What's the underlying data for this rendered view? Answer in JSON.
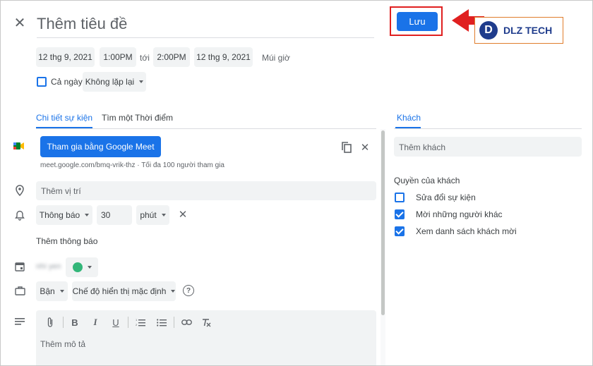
{
  "header": {
    "title_placeholder": "Thêm tiêu đề",
    "save_label": "Lưu"
  },
  "watermark": {
    "brand": "DLZ TECH",
    "letter": "D"
  },
  "datetime": {
    "start_date": "12 thg 9, 2021",
    "start_time": "1:00PM",
    "to_label": "tới",
    "end_time": "2:00PM",
    "end_date": "12 thg 9, 2021",
    "timezone_label": "Múi giờ",
    "all_day_label": "Cả ngày",
    "all_day_checked": false,
    "repeat_value": "Không lặp lại"
  },
  "tabs": [
    {
      "label": "Chi tiết sự kiện",
      "active": true
    },
    {
      "label": "Tìm một Thời điểm",
      "active": false
    }
  ],
  "meet": {
    "button_label": "Tham gia bằng Google Meet",
    "info": "meet.google.com/bmq-vrik-thz · Tối đa 100 người tham gia"
  },
  "location": {
    "placeholder": "Thêm vị trí"
  },
  "notification": {
    "type": "Thông báo",
    "amount": "30",
    "unit": "phút",
    "add_label": "Thêm thông báo"
  },
  "calendar": {
    "name": "nhi yen",
    "color": "#33b679"
  },
  "availability": {
    "busy_value": "Bận",
    "visibility_value": "Chế độ hiển thị mặc định"
  },
  "description": {
    "placeholder": "Thêm mô tả"
  },
  "guests": {
    "tab_label": "Khách",
    "input_placeholder": "Thêm khách",
    "permissions_title": "Quyền của khách",
    "permissions": [
      {
        "label": "Sửa đổi sự kiện",
        "checked": false
      },
      {
        "label": "Mời những người khác",
        "checked": true
      },
      {
        "label": "Xem danh sách khách mời",
        "checked": true
      }
    ]
  },
  "colors": {
    "accent": "#1a73e8",
    "highlight": "#e02020",
    "brand": "#1f3c8c"
  }
}
